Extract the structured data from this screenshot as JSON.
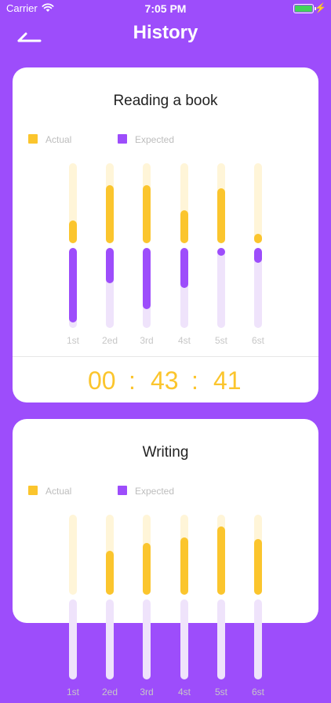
{
  "status_bar": {
    "carrier": "Carrier",
    "time": "7:05 PM"
  },
  "header": {
    "title": "History"
  },
  "colors": {
    "background": "#9d4dfb",
    "actual": "#fbc52d",
    "expected": "#9d4dfb"
  },
  "cards": [
    {
      "title": "Reading a book",
      "legend": {
        "actual_label": "Actual",
        "expected_label": "Expected"
      },
      "categories": [
        "1st",
        "2ed",
        "3rd",
        "4st",
        "5st",
        "6st"
      ],
      "actual_pct": [
        28,
        73,
        73,
        41,
        69,
        12
      ],
      "expected_pct": [
        93,
        44,
        76,
        50,
        7,
        19
      ],
      "timer": {
        "hours": "00",
        "minutes": "43",
        "seconds": "41",
        "separator": ":"
      }
    },
    {
      "title": "Writing",
      "legend": {
        "actual_label": "Actual",
        "expected_label": "Expected"
      },
      "categories": [
        "1st",
        "2ed",
        "3rd",
        "4st",
        "5st",
        "6st"
      ],
      "actual_pct": [
        0,
        55,
        65,
        72,
        85,
        70
      ],
      "expected_pct": [],
      "timer": null
    }
  ]
}
